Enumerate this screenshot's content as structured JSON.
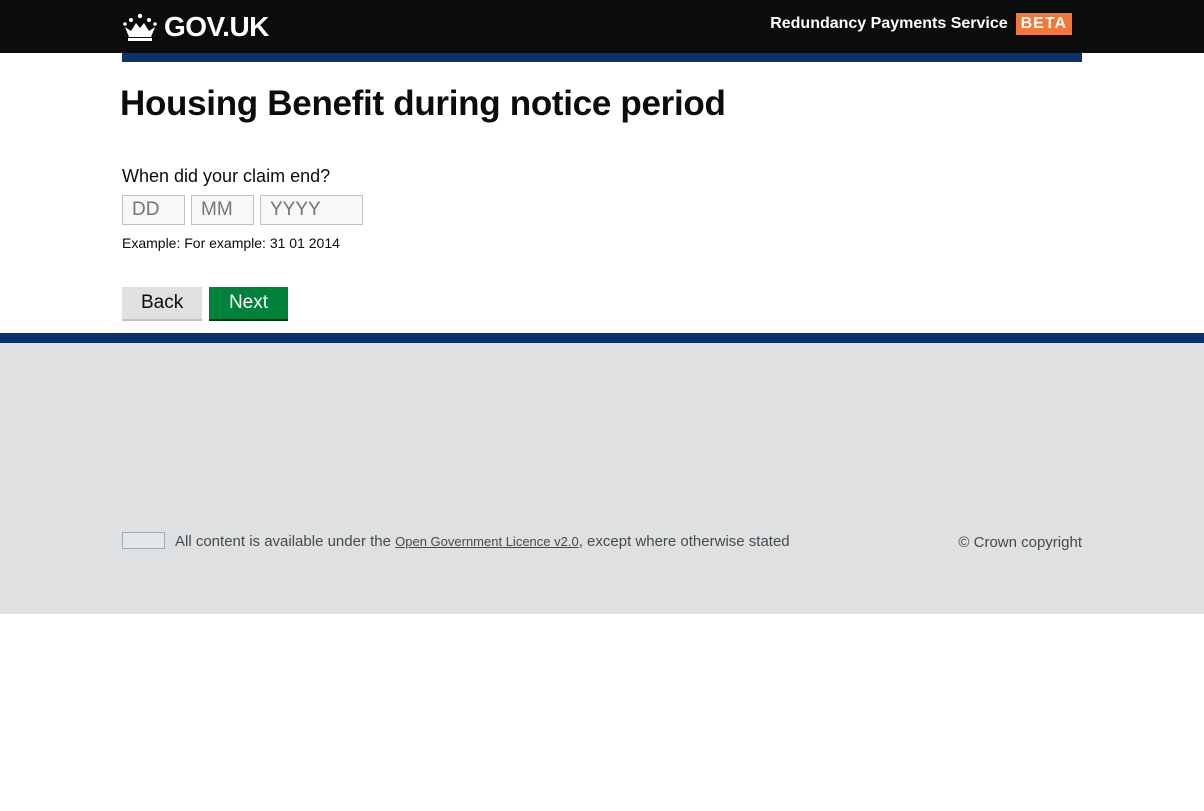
{
  "header": {
    "logo_text": "GOV.UK",
    "service_name": "Redundancy Payments Service",
    "phase_tag": "BETA"
  },
  "main": {
    "title": "Housing Benefit during notice period",
    "question": "When did your claim end?",
    "date_inputs": {
      "day_placeholder": "DD",
      "month_placeholder": "MM",
      "year_placeholder": "YYYY",
      "day_value": "",
      "month_value": "",
      "year_value": ""
    },
    "hint": "Example: For example: 31 01 2014",
    "back_label": "Back",
    "next_label": "Next"
  },
  "footer": {
    "licence_prefix": "All content is available under the ",
    "licence_link": "Open Government Licence v2.0",
    "licence_suffix": ", except where otherwise stated",
    "copyright": "© Crown copyright"
  },
  "colors": {
    "header_bg": "#0b0c0c",
    "brand_blue": "#0b316e",
    "beta_tag": "#f47738",
    "primary_button": "#00823b",
    "secondary_button": "#dee0e2",
    "footer_bg": "#dee0e2"
  }
}
